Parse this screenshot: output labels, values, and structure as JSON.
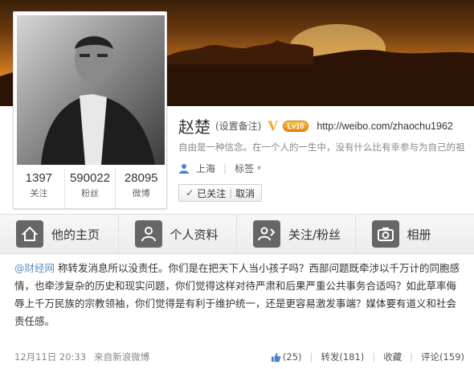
{
  "profile": {
    "name": "赵楚",
    "remark_link": "(设置备注)",
    "verified_mark": "V",
    "level_badge": "Lv10",
    "url": "http://weibo.com/zhaochu1962",
    "motto": "自由是一种信念。在一个人的一生中，没有什么比有幸参与为自己的祖",
    "location": "上海",
    "tags_label": "标签",
    "icons": {
      "location": "person-icon",
      "tags": "chevron-down-icon"
    },
    "stats": [
      {
        "num": "1397",
        "label": "关注"
      },
      {
        "num": "590022",
        "label": "粉丝"
      },
      {
        "num": "28095",
        "label": "微博"
      }
    ],
    "follow_button": {
      "check": "✓",
      "followed": "已关注",
      "cancel": "取消"
    }
  },
  "nav": {
    "tabs": [
      {
        "label": "他的主页",
        "icon": "home-icon"
      },
      {
        "label": "个人资料",
        "icon": "profile-icon"
      },
      {
        "label": "关注/粉丝",
        "icon": "follow-icon"
      },
      {
        "label": "相册",
        "icon": "camera-icon"
      }
    ]
  },
  "post": {
    "mention": "@财经网",
    "text": " 称转发消息所以没责任。你们是在把天下人当小孩子吗？西部问题既牵涉以千万计的同胞感情，也牵涉复杂的历史和现实问题，你们觉得这样对待严肃和后果严重公共事务合适吗？如此草率侮辱上千万民族的宗教领袖，你们觉得是有利于维护统一，还是更容易激发事端？媒体要有道义和社会责任感。",
    "time": "12月11日 20:33",
    "source": "来自新浪微博",
    "like": "(25)",
    "repost": "转发(181)",
    "favorite": "收藏",
    "comment": "评论(159)"
  },
  "colors": {
    "mention": "#5a8fbd",
    "verified": "#f5a623",
    "banner_top": "#3a1f08",
    "banner_bottom": "#f7c060"
  }
}
